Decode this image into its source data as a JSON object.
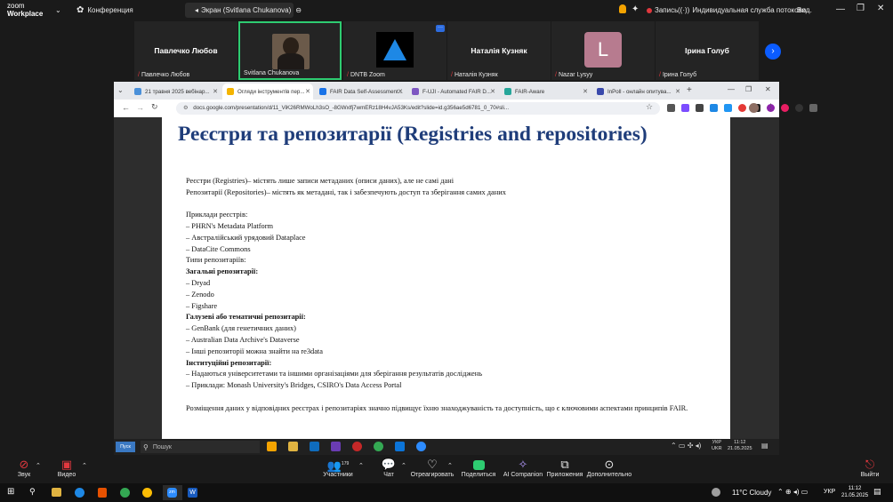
{
  "zoom": {
    "app_name_line1": "zoom",
    "app_name_line2": "Workplace",
    "meeting_label": "Конференция",
    "share_label": "Экран (Svitlana Chukanova)",
    "record_label": "Запись",
    "service_label": "Индивидуальная служба потоково...",
    "view_label": "Вид",
    "participants": [
      {
        "display": "Павлечко Любов",
        "label": "Павлечко Любов",
        "type": "name"
      },
      {
        "display": "",
        "label": "Svitlana Chukanova",
        "type": "photo"
      },
      {
        "display": "",
        "label": "DNTB Zoom",
        "type": "logo"
      },
      {
        "display": "Наталія Кузняк",
        "label": "Наталія Кузняк",
        "type": "name"
      },
      {
        "display": "L",
        "label": "Nazar Lysyy",
        "type": "avatar"
      },
      {
        "display": "Ірина Голуб",
        "label": "Ірина Голуб",
        "type": "name"
      }
    ],
    "toolbar": {
      "audio": "Звук",
      "video": "Видео",
      "participants": "Участники",
      "participants_count": "179",
      "chat": "Чат",
      "react": "Отреагировать",
      "share": "Поделиться",
      "ai": "AI Companion",
      "apps": "Приложения",
      "more": "Дополнительно",
      "leave": "Выйти"
    }
  },
  "browser": {
    "tabs": [
      {
        "label": "21 травня 2025 вебінар...",
        "color": "#4a90d9"
      },
      {
        "label": "Огляди інструментів пер...",
        "color": "#f4b400",
        "active": true
      },
      {
        "label": "FAIR Data Self-Assessment...",
        "color": "#1a73e8"
      },
      {
        "label": "F-UJI - Automated FAIR D...",
        "color": "#7e57c2"
      },
      {
        "label": "FAIR-Aware",
        "color": "#26a69a"
      },
      {
        "label": "InPoll - онлайн опитува...",
        "color": "#3949ab"
      }
    ],
    "url": "docs.google.com/presentation/d/11_ViK26RMWoLh3sO_-8GWxlfj7wmERz18H4vJA53Ks/edit?slide=id.g356ae5d6781_0_70#sli..."
  },
  "slide": {
    "title": "Реєстри та репозитарії (Registries and repositories)",
    "lines": [
      {
        "text": "Реєстри (Registries)– містять лише записи метаданих (описи даних), але не самі дані",
        "bold": false
      },
      {
        "text": "Репозитарії (Repositories)– містять як метадані, так і забезпечують доступ та зберігання самих даних",
        "bold": false
      },
      {
        "text": "",
        "bold": false
      },
      {
        "text": "Приклади реєстрів:",
        "bold": false
      },
      {
        "text": "– PHRN's Metadata Platform",
        "bold": false
      },
      {
        "text": "– Австралійський урядовий Dataplace",
        "bold": false
      },
      {
        "text": "– DataCite Commons",
        "bold": false
      },
      {
        "text": "Типи репозитаріїв:",
        "bold": false
      },
      {
        "text": "Загальні репозитарії:",
        "bold": true
      },
      {
        "text": "– Dryad",
        "bold": false
      },
      {
        "text": "– Zenodo",
        "bold": false
      },
      {
        "text": "– Figshare",
        "bold": false
      },
      {
        "text": "Галузеві або тематичні репозитарії:",
        "bold": true
      },
      {
        "text": "– GenBank (для генетичних даних)",
        "bold": false
      },
      {
        "text": "– Australian Data Archive's Dataverse",
        "bold": false
      },
      {
        "text": "– Інші репозиторії можна знайти на re3data",
        "bold": false
      },
      {
        "text": "Інституційні репозитарії:",
        "bold": true
      },
      {
        "text": "– Надаються університетами та іншими організаціями для зберігання результатів досліджень",
        "bold": false
      },
      {
        "text": "– Приклади: Monash University's Bridges, CSIRO's Data Access Portal",
        "bold": false
      },
      {
        "text": "",
        "bold": false
      },
      {
        "text": "Розміщення даних у відповідних реєстрах і репозитаріях значно підвищує їхню знаходжуваність та доступність, що є ключовими аспектами принципів FAIR.",
        "bold": false
      }
    ]
  },
  "inner_taskbar": {
    "search_placeholder": "Пошук",
    "lang_top": "УКР",
    "lang_bottom": "UKR",
    "time": "11:12",
    "date": "21.05.2025"
  },
  "os_taskbar": {
    "weather": "11°C  Cloudy",
    "lang": "УКР",
    "time": "11:12",
    "date": "21.05.2025"
  },
  "colors": {
    "slide_title": "#1f3d7a",
    "record_dot": "#e0383e",
    "share_green": "#2ecc71",
    "active_speaker": "#2ecc71"
  }
}
